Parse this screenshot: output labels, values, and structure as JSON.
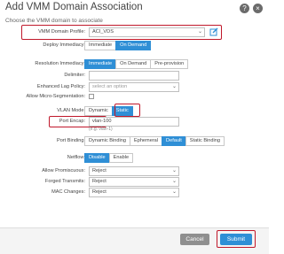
{
  "dialog": {
    "title": "Add VMM Domain Association",
    "subtitle": "Choose the VMM domain to associate",
    "help_glyph": "?",
    "close_glyph": "×"
  },
  "form": {
    "vmm_domain_profile": {
      "label": "VMM Domain Profile:",
      "value": "ACI_VDS"
    },
    "deploy_immediacy": {
      "label": "Deploy Immediacy:",
      "options": [
        "Immediate",
        "On Demand"
      ],
      "selected": "On Demand"
    },
    "resolution_immediacy": {
      "label": "Resolution Immediacy:",
      "options": [
        "Immediate",
        "On Demand",
        "Pre-provision"
      ],
      "selected": "Immediate"
    },
    "delimiter": {
      "label": "Delimiter:",
      "value": ""
    },
    "enhanced_lag_policy": {
      "label": "Enhanced Lag Policy:",
      "placeholder": "select an option"
    },
    "allow_micro_segmentation": {
      "label": "Allow Micro-Segmentation:",
      "checked": false
    },
    "vlan_mode": {
      "label": "VLAN Mode:",
      "options": [
        "Dynamic",
        "Static"
      ],
      "selected": "Static"
    },
    "port_encap": {
      "label": "Port Encap:",
      "value": "vlan-100",
      "hint": "(e.g. vlan-1)"
    },
    "port_binding": {
      "label": "Port Binding:",
      "options": [
        "Dynamic Binding",
        "Ephemeral",
        "Default",
        "Static Binding"
      ],
      "selected": "Default"
    },
    "netflow": {
      "label": "Netflow:",
      "options": [
        "Disable",
        "Enable"
      ],
      "selected": "Disable"
    },
    "allow_promiscuous": {
      "label": "Allow Promiscuous:",
      "value": "Reject"
    },
    "forged_transmits": {
      "label": "Forged Transmits:",
      "value": "Reject"
    },
    "mac_changes": {
      "label": "MAC Changes:",
      "value": "Reject"
    }
  },
  "footer": {
    "cancel_label": "Cancel",
    "submit_label": "Submit"
  },
  "colors": {
    "accent": "#2f8fd6",
    "highlight_box": "#c0182b",
    "cancel": "#8f8f8f"
  },
  "icons": {
    "dropdown": "chevron-down-icon",
    "edit": "edit-icon",
    "help": "help-icon",
    "close": "close-icon"
  }
}
